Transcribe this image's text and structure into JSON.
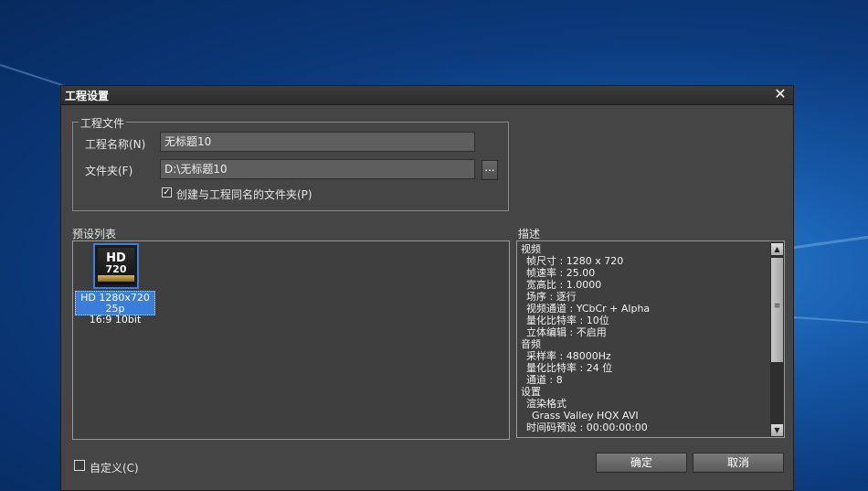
{
  "dialog": {
    "title": "工程设置",
    "close_icon": "close-icon"
  },
  "project_file": {
    "group_label": "工程文件",
    "name_label": "工程名称(N)",
    "name_value": "无标题10",
    "folder_label": "文件夹(F)",
    "folder_value": "D:\\无标题10",
    "browse_label": "...",
    "create_folder_label": "创建与工程同名的文件夹(P)",
    "create_folder_checked": true
  },
  "presets": {
    "label": "预设列表",
    "items": [
      {
        "icon_text_top": "HD",
        "icon_text_bottom": "720",
        "line1": "HD 1280x720 25p",
        "line2": "16:9 10bit",
        "selected": true
      }
    ]
  },
  "description": {
    "label": "描述",
    "lines": [
      "视频",
      "  帧尺寸 : 1280 x 720",
      "  帧速率 : 25.00",
      "  宽高比 : 1.0000",
      "  场序 : 逐行",
      "  视频通道 : YCbCr  + Alpha",
      "  量化比特率 : 10位",
      "  立体编辑 : 不启用",
      "音频",
      "  采样率 : 48000Hz",
      "  量化比特率 : 24 位",
      "  通道 : 8",
      "设置",
      "  渲染格式",
      "    Grass Valley HQX AVI",
      "  时间码预设 : 00:00:00:00"
    ]
  },
  "footer": {
    "custom_label": "自定义(C)",
    "custom_checked": false,
    "ok_label": "确定",
    "cancel_label": "取消"
  },
  "colors": {
    "dialog_bg": "#454545",
    "selection": "#3b7ed9",
    "desktop": "#1659a8"
  }
}
